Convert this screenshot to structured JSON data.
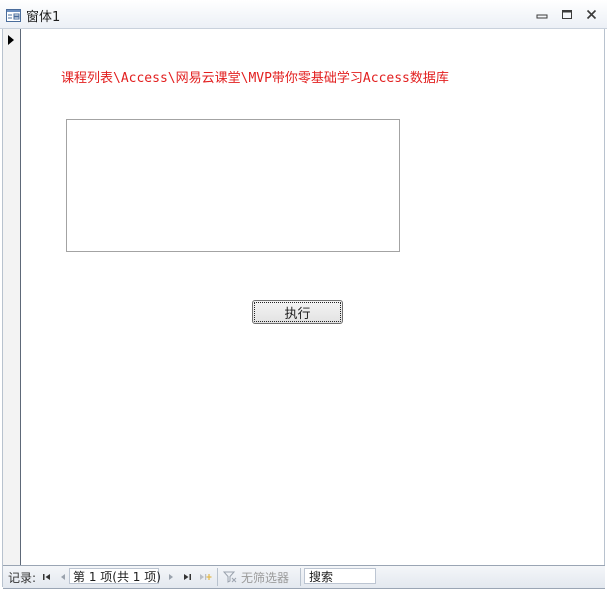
{
  "window": {
    "title": "窗体1",
    "colors": {
      "titlebar": "#ecf0f6",
      "frame": "#b8c2ce"
    }
  },
  "form": {
    "path_label": "课程列表\\Access\\网易云课堂\\MVP带你零基础学习Access数据库",
    "path_label_color": "#e21f1f",
    "textbox_value": "",
    "execute_button_label": "执行"
  },
  "navigation": {
    "record_label": "记录:",
    "current_record": "第 1 项(共 1 项)",
    "filter_status": "无筛选器",
    "search_placeholder": "搜索",
    "icons": [
      "first-record-icon",
      "previous-record-icon",
      "next-record-icon",
      "last-record-icon",
      "new-record-icon",
      "filter-icon"
    ]
  }
}
